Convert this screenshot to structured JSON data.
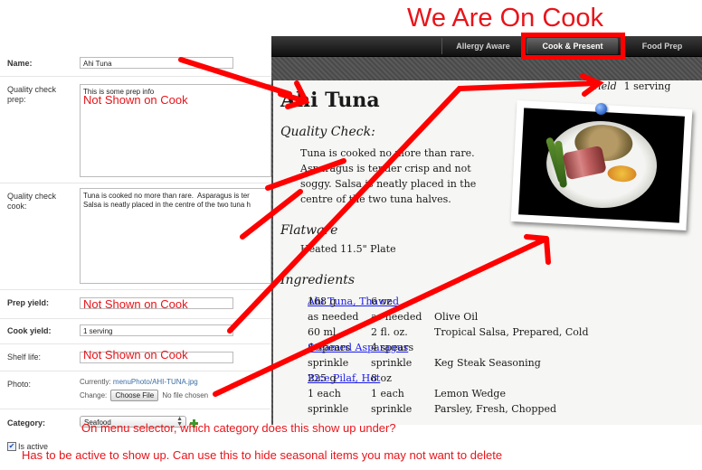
{
  "title_annotation": "We Are On Cook",
  "form": {
    "name_label": "Name:",
    "name_value": "Ahi Tuna",
    "qc_prep_label": "Quality check prep:",
    "qc_prep_value": "This is some prep info",
    "qc_cook_label": "Quality check cook:",
    "qc_cook_value": "Tuna is cooked no more than rare.  Asparagus is ter\nSalsa is neatly placed in the centre of the two tuna h",
    "prep_yield_label": "Prep yield:",
    "prep_yield_value": "",
    "cook_yield_label": "Cook yield:",
    "cook_yield_value": "1 serving",
    "shelf_life_label": "Shelf life:",
    "shelf_life_value": "",
    "photo_label": "Photo:",
    "photo_currently": "Currently:",
    "photo_file": "menuPhoto/AHI-TUNA.jpg",
    "photo_change": "Change:",
    "choose_file": "Choose File",
    "no_file": "No file chosen",
    "category_label": "Category:",
    "category_value": "Seafood",
    "is_active_label": "Is active",
    "is_active_checked": true
  },
  "notes": {
    "not_shown_prep": "Not Shown on Cook",
    "not_shown_prep_yield": "Not Shown on Cook",
    "not_shown_shelf": "Not Shown on Cook",
    "category_note": "On menu selector, which category does this show up under?",
    "active_note": "Has to be active to show up. Can use this to hide seasonal items you may not want to delete"
  },
  "app": {
    "tabs": [
      "Allergy Aware",
      "Cook & Present",
      "Food Prep"
    ],
    "active_tab": "Cook & Present",
    "title": "Ahi Tuna",
    "yield_label": "Yield",
    "yield_value": "1 serving",
    "quality_heading": "Quality Check:",
    "quality_text": "Tuna is cooked no more than rare. Asparagus is tender crisp and not soggy. Salsa is neatly placed in the centre of the two tuna halves.",
    "flatware_heading": "Flatware",
    "flatware_value": "Heated 11.5\" Plate",
    "ingredients_heading": "Ingredients",
    "ingredients": [
      {
        "metric": "168 g",
        "imperial": "6 oz",
        "name": "Ahi Tuna, Thawed",
        "link": true
      },
      {
        "metric": "as needed",
        "imperial": "as needed",
        "name": "Olive Oil",
        "link": false
      },
      {
        "metric": "60 ml",
        "imperial": "2 fl. oz.",
        "name": "Tropical Salsa, Prepared, Cold",
        "link": false
      },
      {
        "metric": "4 spears",
        "imperial": "4 spears",
        "name": "Steamed Asparagus",
        "link": true
      },
      {
        "metric": "sprinkle",
        "imperial": "sprinkle",
        "name": "Keg Steak Seasoning",
        "link": false
      },
      {
        "metric": "225 g",
        "imperial": "8 oz",
        "name": "Rice Pilaf, Hot",
        "link": true
      },
      {
        "metric": "1 each",
        "imperial": "1 each",
        "name": "Lemon Wedge",
        "link": false
      },
      {
        "metric": "sprinkle",
        "imperial": "sprinkle",
        "name": "Parsley, Fresh, Chopped",
        "link": false
      }
    ]
  },
  "colors": {
    "annotation_red": "#ff0000",
    "link_blue": "#1a1aee",
    "topbar": "#1b1b1b"
  }
}
